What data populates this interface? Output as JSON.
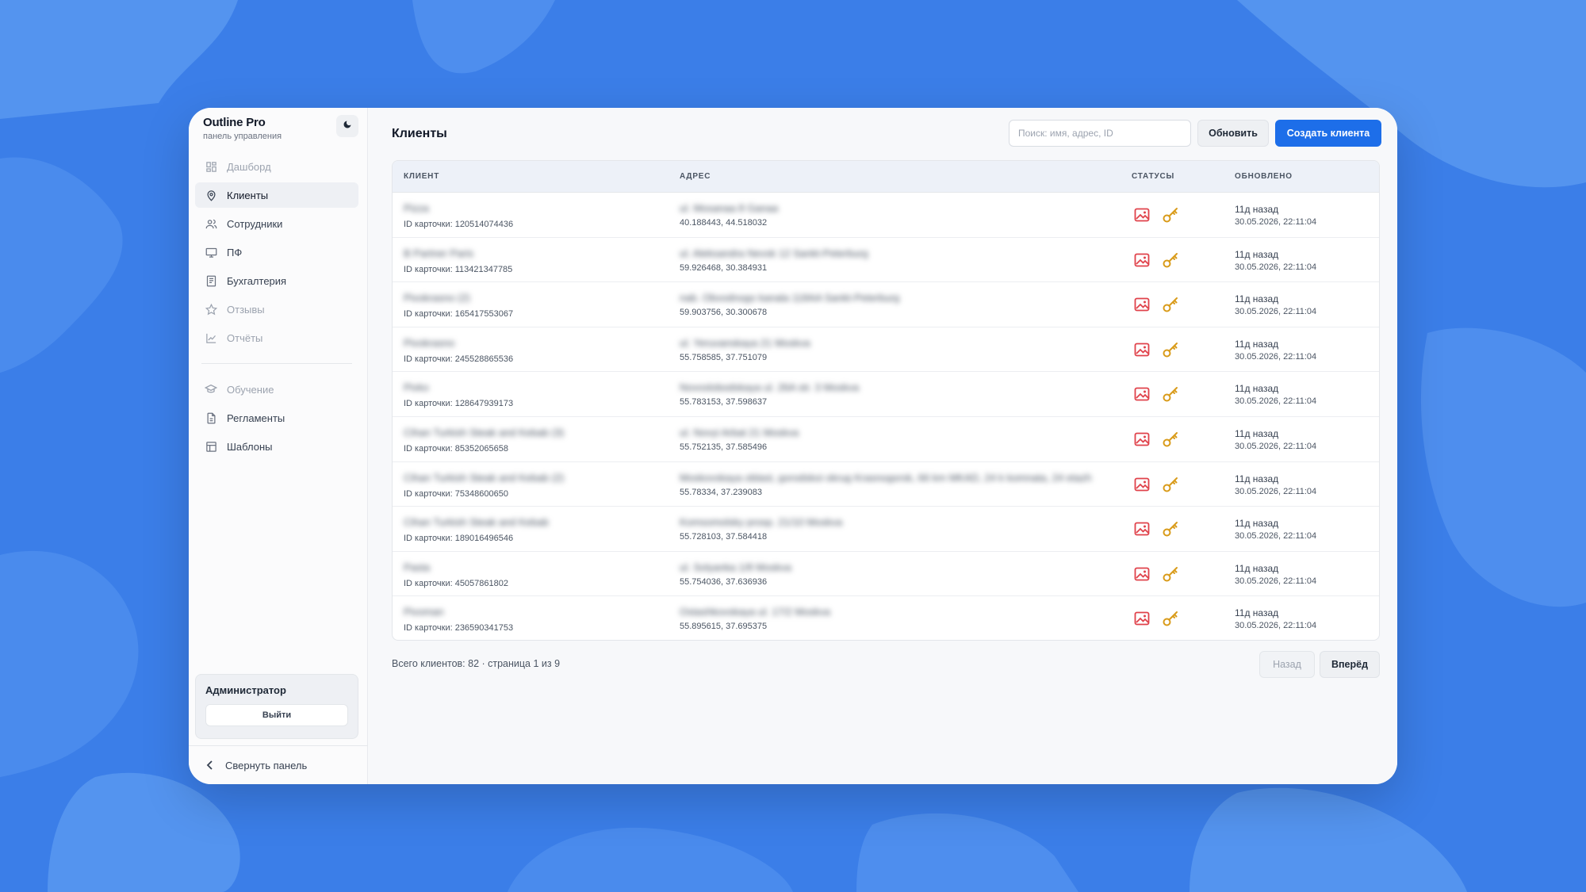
{
  "colors": {
    "background": "#3b7ee8",
    "accent": "#1d6ee9",
    "status_image": "#e0424b",
    "status_key": "#d99b1a"
  },
  "brand": {
    "title": "Outline Pro",
    "subtitle": "панель управления",
    "theme_icon": "moon-icon"
  },
  "sidebar": {
    "items": [
      {
        "label": "Дашборд",
        "icon": "dashboard-icon",
        "state": "dim"
      },
      {
        "label": "Клиенты",
        "icon": "map-pin-icon",
        "state": "active"
      },
      {
        "label": "Сотрудники",
        "icon": "users-icon",
        "state": "normal"
      },
      {
        "label": "ПФ",
        "icon": "monitor-icon",
        "state": "normal"
      },
      {
        "label": "Бухгалтерия",
        "icon": "document-icon",
        "state": "normal"
      },
      {
        "label": "Отзывы",
        "icon": "star-icon",
        "state": "dim"
      },
      {
        "label": "Отчёты",
        "icon": "chart-icon",
        "state": "dim"
      }
    ],
    "items2": [
      {
        "label": "Обучение",
        "icon": "graduation-cap-icon",
        "state": "dim"
      },
      {
        "label": "Регламенты",
        "icon": "file-text-icon",
        "state": "normal"
      },
      {
        "label": "Шаблоны",
        "icon": "layout-icon",
        "state": "normal"
      }
    ],
    "admin": {
      "name": "Администратор",
      "logout_label": "Выйти"
    },
    "collapse_label": "Свернуть панель"
  },
  "main": {
    "title": "Клиенты",
    "search": {
      "placeholder": "Поиск: имя, адрес, ID",
      "value": ""
    },
    "refresh_label": "Обновить",
    "create_label": "Создать клиента"
  },
  "table": {
    "headers": {
      "client": "КЛИЕНТ",
      "address": "АДРЕС",
      "statuses": "СТАТУСЫ",
      "updated": "ОБНОВЛЕНО"
    },
    "rows": [
      {
        "name": "Pizza",
        "card_id": "ID карточки: 120514074436",
        "address": "ul. Mosanaa 8 Ganaa",
        "coords": "40.188443, 44.518032",
        "updated_rel": "11д назад",
        "updated_abs": "30.05.2026, 22:11:04"
      },
      {
        "name": "B Partner Paris",
        "card_id": "ID карточки: 113421347785",
        "address": "ul. Aleksandra Nevsk 12 Sankt-Peterburg",
        "coords": "59.926468, 30.384931",
        "updated_rel": "11д назад",
        "updated_abs": "30.05.2026, 22:11:04"
      },
      {
        "name": "Pivokrasno (2)",
        "card_id": "ID карточки: 165417553067",
        "address": "nab. Obvodnogo kanala 118AA Sankt-Peterburg",
        "coords": "59.903756, 30.300678",
        "updated_rel": "11д назад",
        "updated_abs": "30.05.2026, 22:11:04"
      },
      {
        "name": "Pivokrasno",
        "card_id": "ID карточки: 245528865536",
        "address": "ul. Yeruvanskaya 21 Moskva",
        "coords": "55.758585, 37.751079",
        "updated_rel": "11д назад",
        "updated_abs": "30.05.2026, 22:11:04"
      },
      {
        "name": "Pivko",
        "card_id": "ID карточки: 128647939173",
        "address": "Novoslobodskaya ul. 26A str. 3 Moskva",
        "coords": "55.783153, 37.598637",
        "updated_rel": "11д назад",
        "updated_abs": "30.05.2026, 22:11:04"
      },
      {
        "name": "Cihan Turkish Steak and Kebab (3)",
        "card_id": "ID карточки: 85352065658",
        "address": "ul. Novyi Arbat 21 Moskva",
        "coords": "55.752135, 37.585496",
        "updated_rel": "11д назад",
        "updated_abs": "30.05.2026, 22:11:04"
      },
      {
        "name": "Cihan Turkish Steak and Kebab (2)",
        "card_id": "ID карточки: 75348600650",
        "address": "Moskovskaya oblast, gorodskoi okrug Krasnogorsk, 66 km MKAD, 24 k komnata, 24 etazh",
        "coords": "55.78334, 37.239083",
        "updated_rel": "11д назад",
        "updated_abs": "30.05.2026, 22:11:04"
      },
      {
        "name": "Cihan Turkish Steak and Kebab",
        "card_id": "ID карточки: 189016496546",
        "address": "Komsomolsky prosp. 21/10 Moskva",
        "coords": "55.728103, 37.584418",
        "updated_rel": "11д назад",
        "updated_abs": "30.05.2026, 22:11:04"
      },
      {
        "name": "Pasta",
        "card_id": "ID карточки: 45057861802",
        "address": "ul. Solyanka 1/8 Moskva",
        "coords": "55.754036, 37.636936",
        "updated_rel": "11д назад",
        "updated_abs": "30.05.2026, 22:11:04"
      },
      {
        "name": "Pivoman",
        "card_id": "ID карточки: 236590341753",
        "address": "Ostashkovskaya ul. 17/2 Moskva",
        "coords": "55.895615, 37.695375",
        "updated_rel": "11д назад",
        "updated_abs": "30.05.2026, 22:11:04"
      }
    ]
  },
  "pagination": {
    "summary": "Всего клиентов: 82 · страница 1 из 9",
    "prev_label": "Назад",
    "next_label": "Вперёд"
  }
}
